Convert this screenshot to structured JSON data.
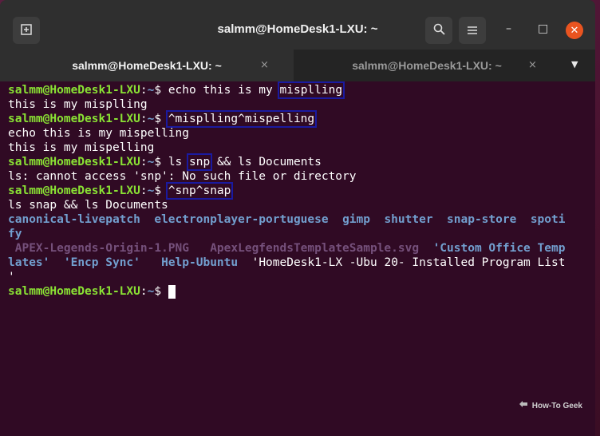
{
  "window": {
    "title": "salmm@HomeDesk1-LXU: ~",
    "new_tab_icon": "new-tab-icon",
    "search_icon": "search-icon",
    "menu_icon": "hamburger-menu-icon",
    "minimize_glyph": "–",
    "maximize_glyph": "□",
    "close_glyph": "✕"
  },
  "tabs": [
    {
      "label": "salmm@HomeDesk1-LXU: ~",
      "active": true,
      "close_glyph": "×"
    },
    {
      "label": "salmm@HomeDesk1-LXU: ~",
      "active": false,
      "close_glyph": "×"
    }
  ],
  "tab_menu_glyph": "▼",
  "prompt": {
    "user": "salmm@HomeDesk1-LXU",
    "sep": ":",
    "path": "~",
    "symbol": "$"
  },
  "terminal": {
    "l1_cmd_a": "echo this is my ",
    "l1_cmd_b": "misplling",
    "l2": "this is my misplling",
    "l3_cmd": "^misplling^mispelling",
    "l4": "echo this is my mispelling",
    "l5": "this is my mispelling",
    "l6_cmd_a": "ls ",
    "l6_cmd_b": "snp",
    "l6_cmd_c": " && ls Documents",
    "l7": "ls: cannot access 'snp': No such file or directory",
    "l8_cmd": "^snp^snap",
    "l9": "ls snap && ls Documents",
    "snap_dirs_line1": [
      "canonical-livepatch",
      "electronplayer-portuguese",
      "gimp",
      "shutter",
      "snap-store",
      "spoti"
    ],
    "snap_dirs_line2": "fy",
    "doc_line1_files": [
      " APEX-Legends-Origin-1.PNG",
      "ApexLegfendsTemplateSample.svg"
    ],
    "doc_line1_dir": "'Custom Office Temp",
    "doc_line2_dirs": [
      "lates'",
      "'Encp Sync'",
      "Help-Ubuntu"
    ],
    "doc_line2_file": "'HomeDesk1-LX -Ubu 20- Installed Program List",
    "doc_line3": "'"
  },
  "watermark": {
    "text": "How-To Geek",
    "logo": "how-to-geek-logo"
  }
}
